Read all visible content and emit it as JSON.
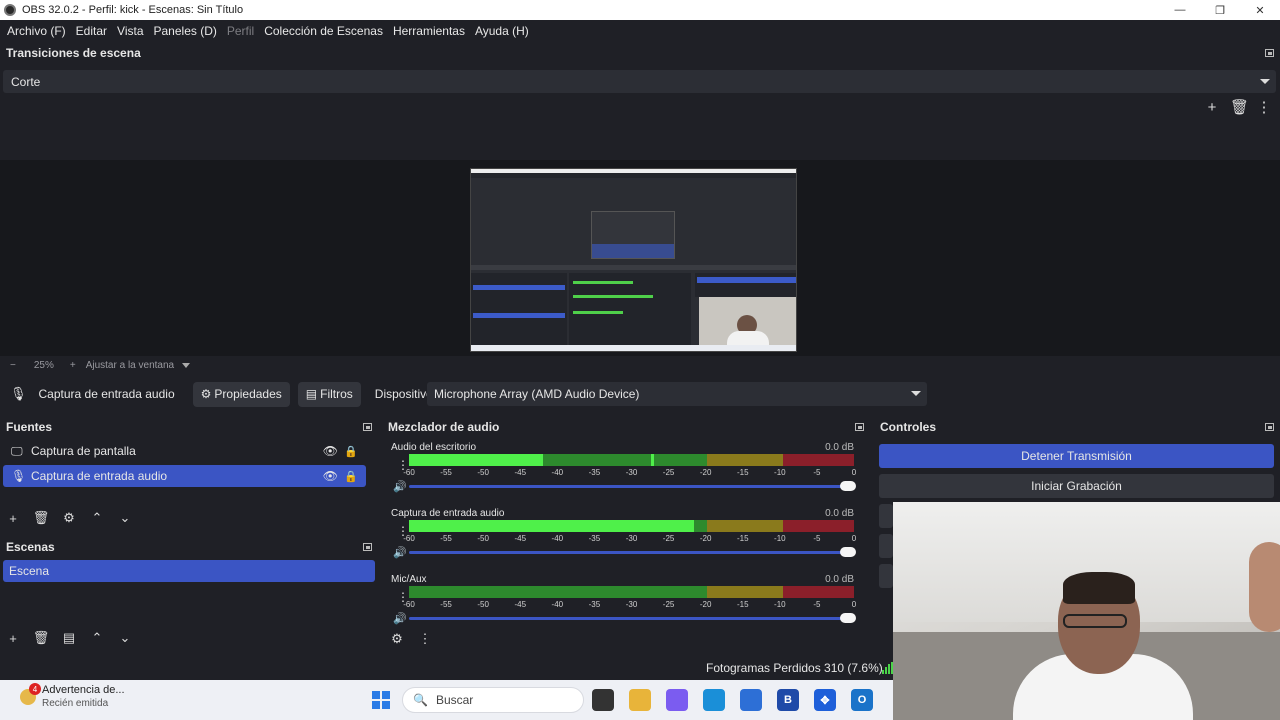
{
  "window": {
    "title": "OBS 32.0.2 - Perfil: kick - Escenas: Sin Título",
    "min_glyph": "—",
    "max_glyph": "❐",
    "close_glyph": "✕"
  },
  "menu": [
    {
      "label": "Archivo (F)",
      "disabled": false
    },
    {
      "label": "Editar",
      "disabled": false
    },
    {
      "label": "Vista",
      "disabled": false
    },
    {
      "label": "Paneles (D)",
      "disabled": false
    },
    {
      "label": "Perfil",
      "disabled": true
    },
    {
      "label": "Colección de Escenas",
      "disabled": false
    },
    {
      "label": "Herramientas",
      "disabled": false
    },
    {
      "label": "Ayuda (H)",
      "disabled": false
    }
  ],
  "transitions": {
    "title": "Transiciones de escena",
    "selected": "Corte",
    "icons": [
      "plus-icon",
      "trash-icon",
      "more-vertical-icon"
    ]
  },
  "zoom": {
    "minus": "−",
    "value": "25%",
    "plus": "+",
    "fit_label": "Ajustar a la ventana"
  },
  "source_bar": {
    "source_name": "Captura de entrada audio",
    "properties_label": "Propiedades",
    "filters_label": "Filtros",
    "device_label": "Dispositivo",
    "device_value": "Microphone Array (AMD Audio Device)"
  },
  "sources": {
    "title": "Fuentes",
    "items": [
      {
        "label": "Captura de pantalla",
        "icon": "monitor-icon",
        "selected": false
      },
      {
        "label": "Captura de entrada audio",
        "icon": "microphone-icon",
        "selected": true
      }
    ]
  },
  "scenes": {
    "title": "Escenas",
    "items": [
      {
        "label": "Escena",
        "selected": true
      }
    ]
  },
  "mixer": {
    "title": "Mezclador de audio",
    "ticks": [
      "-60",
      "-55",
      "-50",
      "-45",
      "-40",
      "-35",
      "-30",
      "-25",
      "-20",
      "-15",
      "-10",
      "-5",
      "0"
    ],
    "channels": [
      {
        "name": "Audio del escritorio",
        "db": "0.0 dB",
        "level": 0.3,
        "peak": 0.55
      },
      {
        "name": "Captura de entrada audio",
        "db": "0.0 dB",
        "level": 0.64,
        "peak": 0.64
      },
      {
        "name": "Mic/Aux",
        "db": "0.0 dB",
        "level": 0.0,
        "peak": 0.0
      }
    ]
  },
  "controls": {
    "title": "Controles",
    "stop_stream_label": "Detener Transmisión",
    "start_record_label": "Iniciar Grabación"
  },
  "status": {
    "dropped_frames": "Fotogramas Perdidos 310 (7.6%)"
  },
  "taskbar": {
    "notification_title": "Advertencia de...",
    "notification_sub": "Recién emitida",
    "notification_badge": "4",
    "search_placeholder": "Buscar",
    "apps": [
      {
        "name": "task-view-icon",
        "color": "#333333",
        "glyph": ""
      },
      {
        "name": "file-explorer-icon",
        "color": "#e8b43a",
        "glyph": ""
      },
      {
        "name": "copilot-icon",
        "color": "#7b5cf0",
        "glyph": ""
      },
      {
        "name": "edge-browser-icon",
        "color": "#1a8fd8",
        "glyph": ""
      },
      {
        "name": "store-icon",
        "color": "#2d6fd6",
        "glyph": ""
      },
      {
        "name": "b-app-icon",
        "color": "#1f4aa8",
        "glyph": "B"
      },
      {
        "name": "dropbox-icon",
        "color": "#1e5fd9",
        "glyph": "✥"
      },
      {
        "name": "outlook-icon",
        "color": "#1a73c9",
        "glyph": "O"
      }
    ]
  },
  "colors": {
    "accent": "#3b55c4",
    "background": "#1f2026",
    "meter_green": "#4ff04a"
  }
}
